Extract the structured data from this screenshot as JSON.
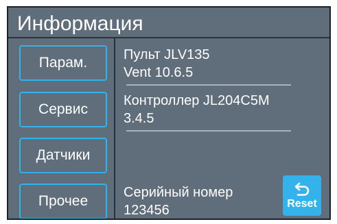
{
  "header": {
    "title": "Информация"
  },
  "nav": {
    "items": [
      {
        "label": "Парам."
      },
      {
        "label": "Сервис"
      },
      {
        "label": "Датчики"
      },
      {
        "label": "Прочее"
      }
    ]
  },
  "info": {
    "remote": {
      "line1": "Пульт JLV135",
      "line2": "Vent 10.6.5"
    },
    "controller": {
      "line1": "Контроллер JL204C5M",
      "line2": "3.4.5"
    },
    "serial": {
      "label": "Серийный номер",
      "value": "123456"
    }
  },
  "reset": {
    "label": "Reset",
    "icon": "undo-arrow-icon"
  },
  "colors": {
    "background": "#606d7b",
    "accent": "#34b2ec",
    "divider": "#2b3139",
    "text": "#ffffff"
  }
}
